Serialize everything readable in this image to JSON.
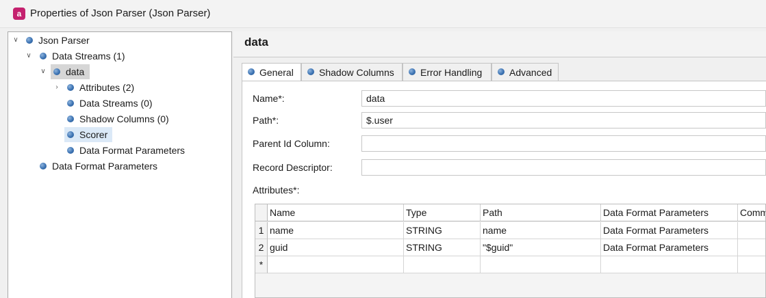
{
  "window": {
    "title": "Properties of Json Parser (Json Parser)",
    "app_icon_text": "a",
    "accent_color": "#c4216e"
  },
  "tree": {
    "items": [
      {
        "label": "Json Parser",
        "expanded": true
      },
      {
        "label": "Data Streams (1)",
        "expanded": true
      },
      {
        "label": "data",
        "expanded": true,
        "selected": true
      },
      {
        "label": "Attributes (2)",
        "expanded": false
      },
      {
        "label": "Data Streams (0)"
      },
      {
        "label": "Shadow Columns (0)"
      },
      {
        "label": "Scorer",
        "hovered": true
      },
      {
        "label": "Data Format Parameters"
      },
      {
        "label": "Data Format Parameters"
      }
    ]
  },
  "panel": {
    "title": "data",
    "tabs": [
      {
        "label": "General",
        "active": true
      },
      {
        "label": "Shadow Columns"
      },
      {
        "label": "Error Handling"
      },
      {
        "label": "Advanced"
      }
    ]
  },
  "form": {
    "name_label": "Name*:",
    "name_value": "data",
    "path_label": "Path*:",
    "path_value": "$.user",
    "parent_id_label": "Parent Id Column:",
    "parent_id_value": "",
    "record_descriptor_label": "Record Descriptor:",
    "record_descriptor_value": "",
    "attributes_label": "Attributes*:"
  },
  "grid": {
    "columns": [
      "Name",
      "Type",
      "Path",
      "Data Format Parameters",
      "Comm"
    ],
    "rows": [
      {
        "num": "1",
        "cells": [
          "name",
          "STRING",
          "name",
          "Data Format Parameters",
          ""
        ]
      },
      {
        "num": "2",
        "cells": [
          "guid",
          "STRING",
          "\"$guid\"",
          "Data Format Parameters",
          ""
        ]
      }
    ],
    "new_row_marker": "*"
  }
}
